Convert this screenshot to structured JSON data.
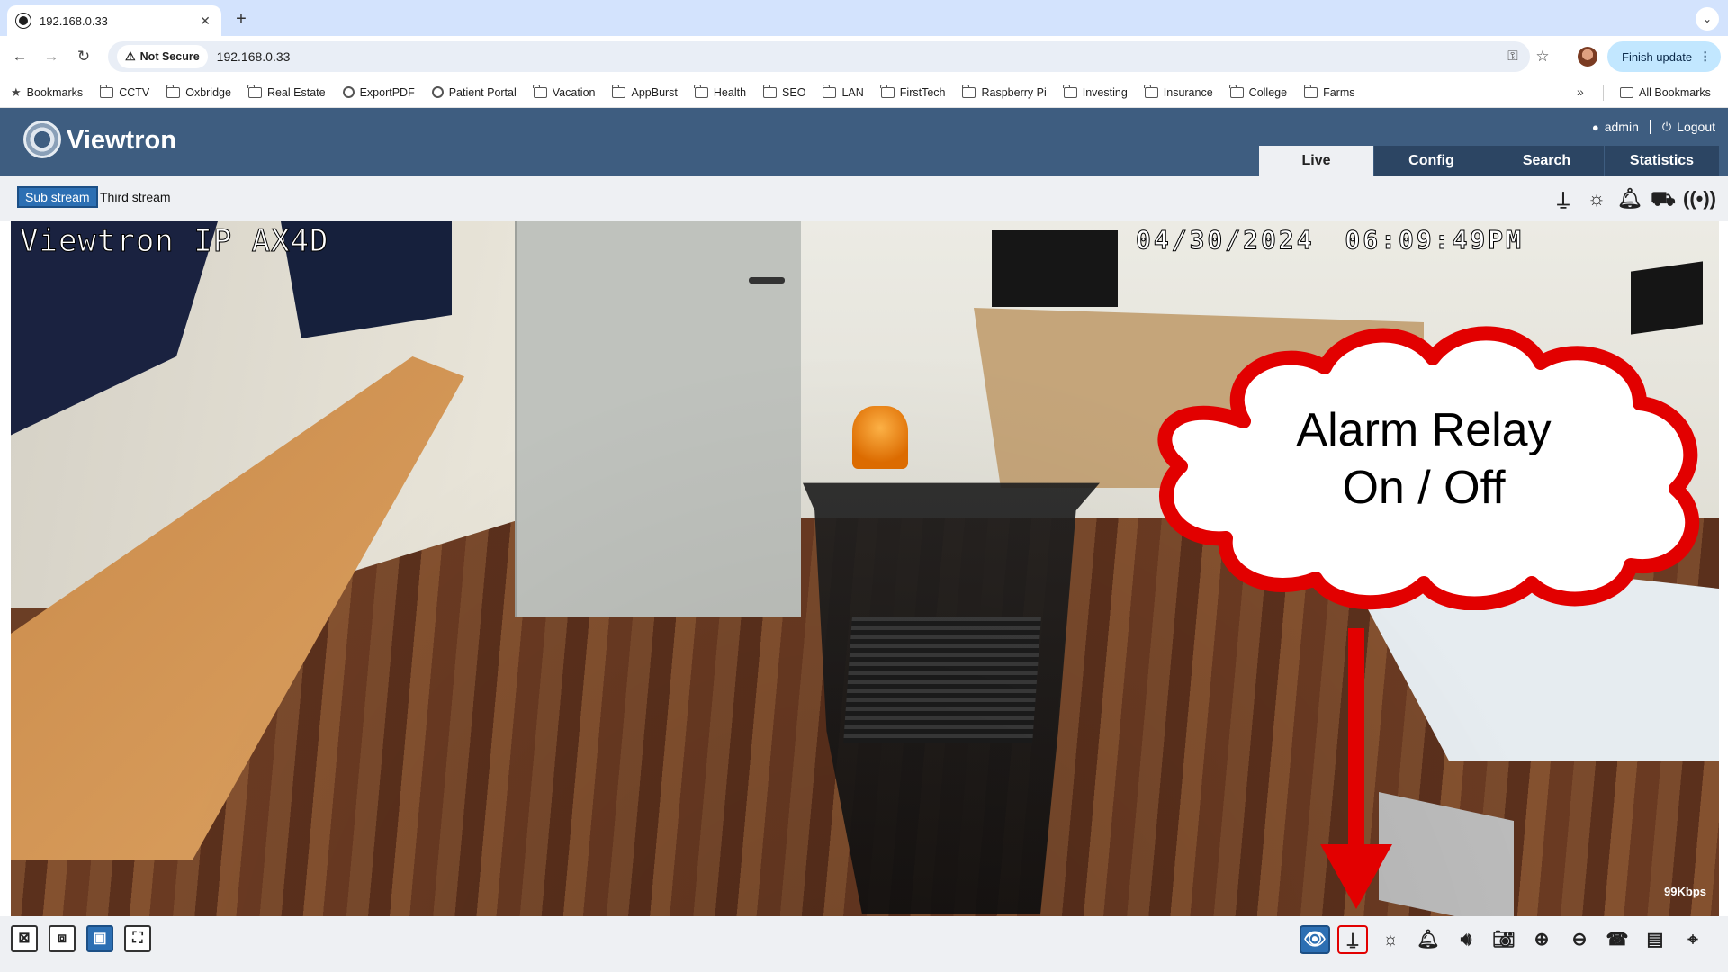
{
  "browser": {
    "tab_title": "192.168.0.33",
    "tab_close": "✕",
    "new_tab": "+",
    "tab_list": "⌄",
    "back": "←",
    "forward": "→",
    "reload": "↻",
    "security_label": "Not Secure",
    "url": "192.168.0.33",
    "key_icon": "⚿",
    "star_icon": "☆",
    "update_label": "Finish update",
    "update_menu": "⋮",
    "bookmarks": [
      {
        "label": "Bookmarks",
        "icon": "star"
      },
      {
        "label": "CCTV",
        "icon": "folder"
      },
      {
        "label": "Oxbridge",
        "icon": "folder"
      },
      {
        "label": "Real Estate",
        "icon": "folder"
      },
      {
        "label": "ExportPDF",
        "icon": "globe"
      },
      {
        "label": "Patient Portal",
        "icon": "globe"
      },
      {
        "label": "Vacation",
        "icon": "folder"
      },
      {
        "label": "AppBurst",
        "icon": "folder"
      },
      {
        "label": "Health",
        "icon": "folder"
      },
      {
        "label": "SEO",
        "icon": "folder"
      },
      {
        "label": "LAN",
        "icon": "folder"
      },
      {
        "label": "FirstTech",
        "icon": "folder"
      },
      {
        "label": "Raspberry Pi",
        "icon": "folder"
      },
      {
        "label": "Investing",
        "icon": "folder"
      },
      {
        "label": "Insurance",
        "icon": "folder"
      },
      {
        "label": "College",
        "icon": "folder"
      },
      {
        "label": "Farms",
        "icon": "folder"
      }
    ],
    "more_bookmarks": "»",
    "all_bookmarks": "All Bookmarks"
  },
  "app": {
    "logo_text": "Viewtron",
    "user": "admin",
    "logout": "Logout",
    "tabs": [
      {
        "label": "Live",
        "active": true
      },
      {
        "label": "Config",
        "active": false
      },
      {
        "label": "Search",
        "active": false
      },
      {
        "label": "Statistics",
        "active": false
      }
    ],
    "streams": [
      {
        "label": "Sub stream",
        "active": true
      },
      {
        "label": "Third stream",
        "active": false
      }
    ],
    "status_icons": [
      "alarm-relay-icon",
      "light-alarm-icon",
      "audio-alarm-icon",
      "motion-alarm-icon",
      "wireless-alarm-icon"
    ]
  },
  "video": {
    "osd_camera_name": "Viewtron IP AX4D",
    "osd_datetime": "04/30/2024 06:09:49PM",
    "bitrate": "99Kbps",
    "callout_line1": "Alarm Relay",
    "callout_line2": "On / Off",
    "accent_color": "#e20000"
  },
  "bottom_toolbar": {
    "left_buttons": [
      "close-window-icon",
      "original-size-icon",
      "fit-window-icon",
      "fullscreen-icon"
    ],
    "right_buttons": [
      "live-view-icon",
      "alarm-relay-icon",
      "white-light-icon",
      "alarm-bell-icon",
      "audio-icon",
      "snapshot-icon",
      "zoom-in-icon",
      "zoom-out-icon",
      "talk-icon",
      "record-icon",
      "ptz-icon"
    ]
  }
}
